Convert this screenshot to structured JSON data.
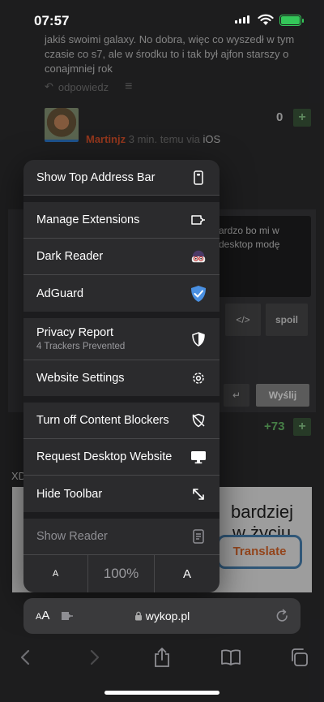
{
  "status_bar": {
    "time": "07:57"
  },
  "background_page": {
    "comment_text": "jakiś swoimi galaxy. No dobra, więc co wyszedł w tym czasie co s7, ale w środku to i tak był ajfon starszy o conajmniej rok",
    "reply_label": "odpowiedz",
    "comment_score": "0",
    "author_name": "Martinjz",
    "author_time": "3 min. temu",
    "author_via": "via",
    "author_platform": "iOS",
    "textbox_text": "ardzo bo mi w desktop modę",
    "code_button": "</>",
    "spoiler_button": "spoil",
    "send_button": "Wyślij",
    "second_score": "+73",
    "xd_text": "XD",
    "image_text_line1": "bardziej",
    "image_text_line2": "w życiu",
    "translate_button": "Translate"
  },
  "menu": {
    "show_top_address_bar": "Show Top Address Bar",
    "manage_extensions": "Manage Extensions",
    "dark_reader": "Dark Reader",
    "adguard": "AdGuard",
    "privacy_report": "Privacy Report",
    "privacy_report_sub": "4 Trackers Prevented",
    "website_settings": "Website Settings",
    "turn_off_content_blockers": "Turn off Content Blockers",
    "request_desktop_website": "Request Desktop Website",
    "hide_toolbar": "Hide Toolbar",
    "show_reader": "Show Reader",
    "zoom_smaller": "A",
    "zoom_level": "100%",
    "zoom_larger": "A"
  },
  "address_bar": {
    "aa_label_small": "A",
    "aa_label_large": "A",
    "url": "wykop.pl"
  },
  "colors": {
    "menu_bg": "#2b2b2d",
    "separator": "#1c1c1e",
    "battery": "#34c759",
    "author_name": "#e0532b",
    "adguard_blue": "#4a90e2"
  }
}
